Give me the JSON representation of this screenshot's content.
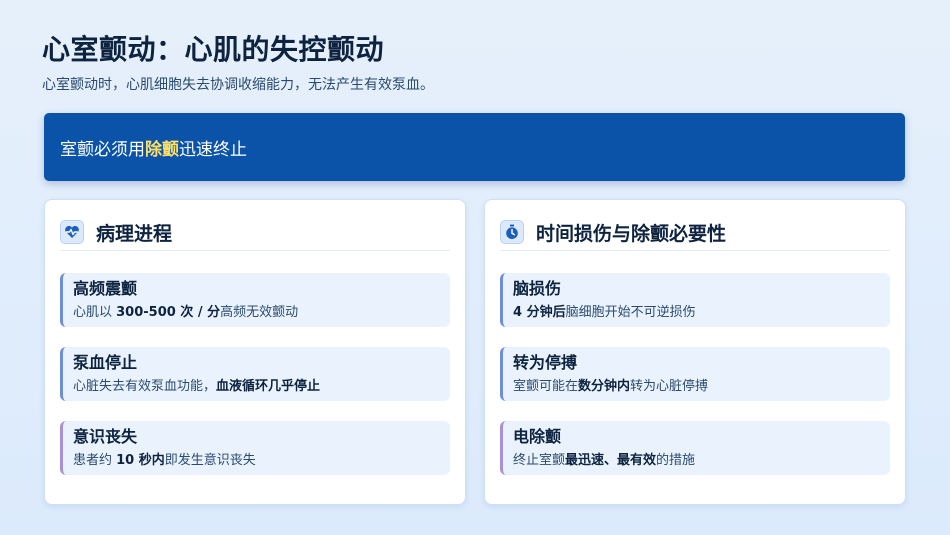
{
  "header": {
    "title": "心室颤动：心肌的失控颤动",
    "subtitle": "心室颤动时，心肌细胞失去协调收缩能力，无法产生有效泵血。"
  },
  "banner": {
    "prefix": "室颤必须用",
    "highlight": "除颤",
    "suffix": "迅速终止"
  },
  "left_panel": {
    "title": "病理进程",
    "icon": "heart-pulse-icon",
    "cards": [
      {
        "title": "高频震颤",
        "pre": "心肌以 ",
        "bold": "300-500 次 / 分",
        "post": "高频无效颤动"
      },
      {
        "title": "泵血停止",
        "pre": "心脏失去有效泵血功能，",
        "bold": "血液循环几乎停止",
        "post": ""
      },
      {
        "title": "意识丧失",
        "pre": "患者约 ",
        "bold": "10 秒内",
        "post": "即发生意识丧失"
      }
    ]
  },
  "right_panel": {
    "title": "时间损伤与除颤必要性",
    "icon": "stopwatch-icon",
    "cards": [
      {
        "title": "脑损伤",
        "pre": "",
        "bold": "4 分钟后",
        "post": "脑细胞开始不可逆损伤"
      },
      {
        "title": "转为停搏",
        "pre": "室颤可能在",
        "bold": "数分钟内",
        "post": "转为心脏停搏"
      },
      {
        "title": "电除颤",
        "pre": "终止室颤",
        "bold": "最迅速、最有效",
        "post": "的措施"
      }
    ]
  },
  "colors": {
    "banner_bg": "#0a53a8",
    "highlight": "#ffe066",
    "accent": "#6c8fd6"
  }
}
